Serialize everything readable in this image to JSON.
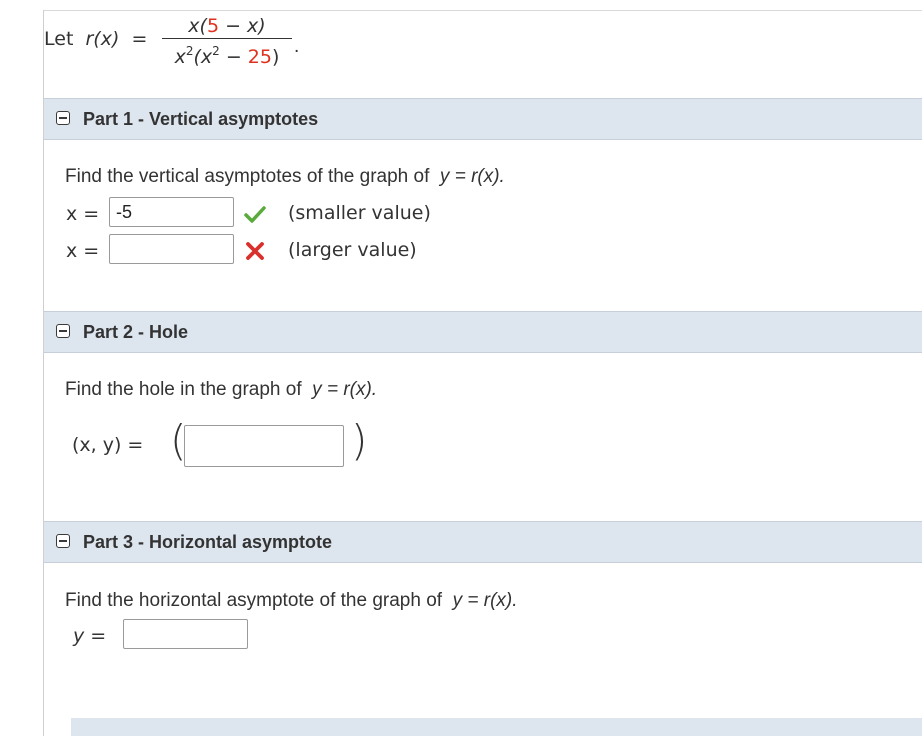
{
  "problem": {
    "let_label": "Let",
    "func": "r(x)",
    "equals": "=",
    "numerator_pre": "x(",
    "numerator_red": "5",
    "numerator_post": " − x)",
    "denominator_pre": "x",
    "denominator_exp": "2",
    "denominator_mid": "(x",
    "denominator_exp2": "2",
    "denominator_minus": " − ",
    "denominator_red": "25",
    "denominator_post": ")",
    "period": "."
  },
  "part1": {
    "title": "Part 1 - Vertical asymptotes",
    "prompt_text": "Find the vertical asymptotes of the graph of",
    "prompt_math": "y = r(x).",
    "row1": {
      "label": "x =",
      "value": "-5",
      "status": "correct",
      "hint": "(smaller value)"
    },
    "row2": {
      "label": "x =",
      "value": "",
      "status": "incorrect",
      "hint": "(larger value)"
    }
  },
  "part2": {
    "title": "Part 2 - Hole",
    "prompt_text": "Find the hole in the graph of",
    "prompt_math": "y = r(x).",
    "label": "(x, y)  =",
    "value": ""
  },
  "part3": {
    "title": "Part 3 - Horizontal asymptote",
    "prompt_text": "Find the horizontal asymptote of the graph of",
    "prompt_math": "y = r(x).",
    "label": "y  =",
    "value": ""
  },
  "colors": {
    "header_bg": "#dde5ee",
    "correct": "#5aaa3c",
    "incorrect": "#d9302b",
    "accent_red": "#e0301e"
  }
}
